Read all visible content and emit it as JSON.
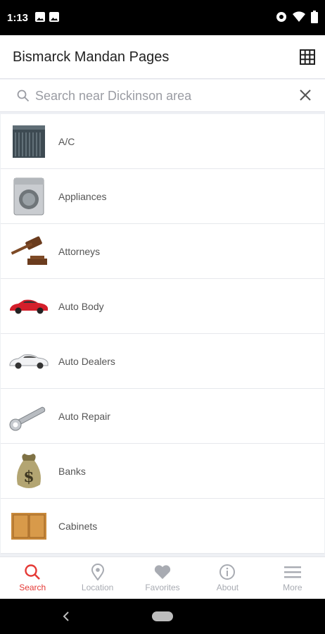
{
  "status_bar": {
    "time": "1:13"
  },
  "app_bar": {
    "title": "Bismarck Mandan Pages",
    "grid_icon": "grid-icon"
  },
  "search": {
    "placeholder": "Search near Dickinson area",
    "value": ""
  },
  "categories": [
    {
      "label": "A/C",
      "icon": "ac-unit-image"
    },
    {
      "label": "Appliances",
      "icon": "washing-machine-image"
    },
    {
      "label": "Attorneys",
      "icon": "gavel-image"
    },
    {
      "label": "Auto Body",
      "icon": "red-car-image"
    },
    {
      "label": "Auto Dealers",
      "icon": "white-car-image"
    },
    {
      "label": "Auto Repair",
      "icon": "wrench-image"
    },
    {
      "label": "Banks",
      "icon": "money-bag-image"
    },
    {
      "label": "Cabinets",
      "icon": "cabinet-image"
    }
  ],
  "bottom_nav": {
    "items": [
      {
        "label": "Search",
        "icon": "search-icon",
        "active": true
      },
      {
        "label": "Location",
        "icon": "location-pin-icon",
        "active": false
      },
      {
        "label": "Favorites",
        "icon": "heart-icon",
        "active": false
      },
      {
        "label": "About",
        "icon": "info-icon",
        "active": false
      },
      {
        "label": "More",
        "icon": "menu-icon",
        "active": false
      }
    ]
  },
  "colors": {
    "accent": "#e53935",
    "inactive": "#a8abb2",
    "background": "#eef0f4"
  }
}
